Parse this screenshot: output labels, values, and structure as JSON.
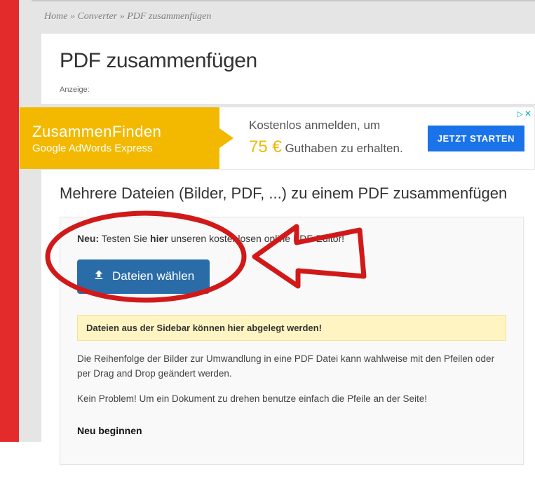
{
  "breadcrumb": {
    "home": "Home",
    "sep1": "»",
    "converter": "Converter",
    "sep2": "»",
    "current": "PDF zusammenfügen"
  },
  "page_title": "PDF zusammenfügen",
  "anzeige_label": "Anzeige:",
  "ad": {
    "title": "ZusammenFinden",
    "sub_brand": "Google",
    "sub_rest": " AdWords Express",
    "line1": "Kostenlos anmelden, um",
    "price": "75 €",
    "line2_rest": " Guthaben zu erhalten.",
    "cta": "JETZT STARTEN",
    "info_triangle": "▷",
    "info_x": "✕"
  },
  "subtitle": "Mehrere Dateien (Bilder, PDF, ...) zu einem PDF zusammenfügen",
  "upload": {
    "neu_label": "Neu:",
    "neu_pre": " Testen Sie ",
    "neu_link": "hier",
    "neu_rest": " unseren kostenlosen online PDF-Editor!",
    "button": "Dateien wählen",
    "dropzone": "Dateien aus der Sidebar können hier abgelegt werden!",
    "reorder_text": "Die Reihenfolge der Bilder zur Umwandlung in eine PDF Datei kann wahlweise mit den Pfeilen oder per Drag and Drop geändert werden.",
    "rotate_text": "Kein Problem! Um ein Dokument zu drehen benutze einfach die Pfeile an der Seite!",
    "restart": "Neu beginnen"
  }
}
